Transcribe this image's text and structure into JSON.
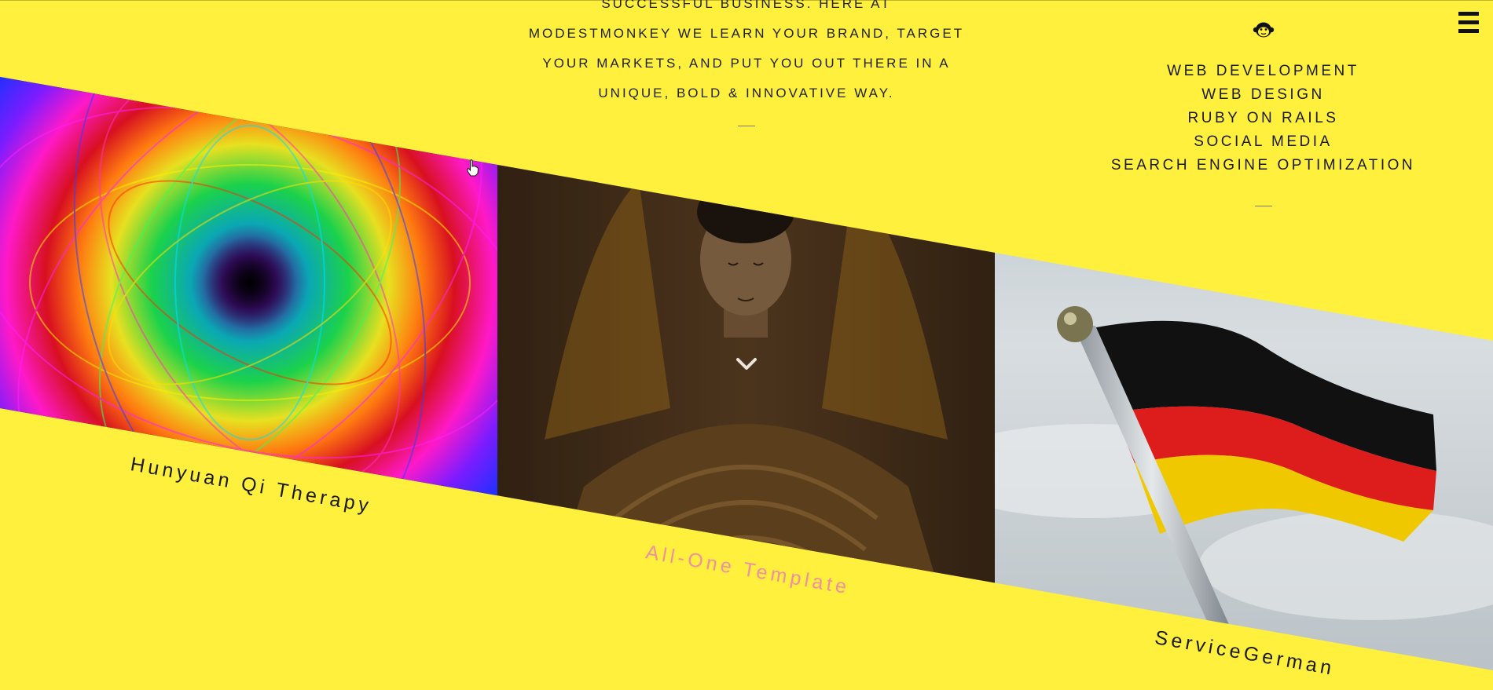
{
  "intro": {
    "clipped_line": "SUCCESSFUL BUSINESS. HERE AT",
    "lines": [
      "MODESTMONKEY WE LEARN YOUR BRAND, TARGET",
      "YOUR MARKETS, AND PUT YOU OUT THERE IN A",
      "UNIQUE, BOLD & INNOVATIVE WAY."
    ]
  },
  "services": {
    "logo_icon": "monkey-icon",
    "items": [
      "WEB DEVELOPMENT",
      "WEB DESIGN",
      "RUBY ON RAILS",
      "SOCIAL MEDIA",
      "SEARCH ENGINE OPTIMIZATION"
    ]
  },
  "menu": {
    "icon": "hamburger-menu-icon"
  },
  "portfolio": {
    "projects": [
      {
        "title": "Hunyuan Qi Therapy",
        "image": "rainbow-mandala-image",
        "label_color": "#1b1b1b"
      },
      {
        "title": "All-One Template",
        "image": "meditating-buddha-image",
        "label_color": "#f08fa4"
      },
      {
        "title": "ServiceGerman",
        "image": "german-flag-image",
        "label_color": "#1b1b1b"
      }
    ],
    "scroll_icon": "chevron-down-icon"
  },
  "colors": {
    "background": "#fef03c",
    "accent_pink": "#f08fa4",
    "text": "#1a1a1a"
  }
}
